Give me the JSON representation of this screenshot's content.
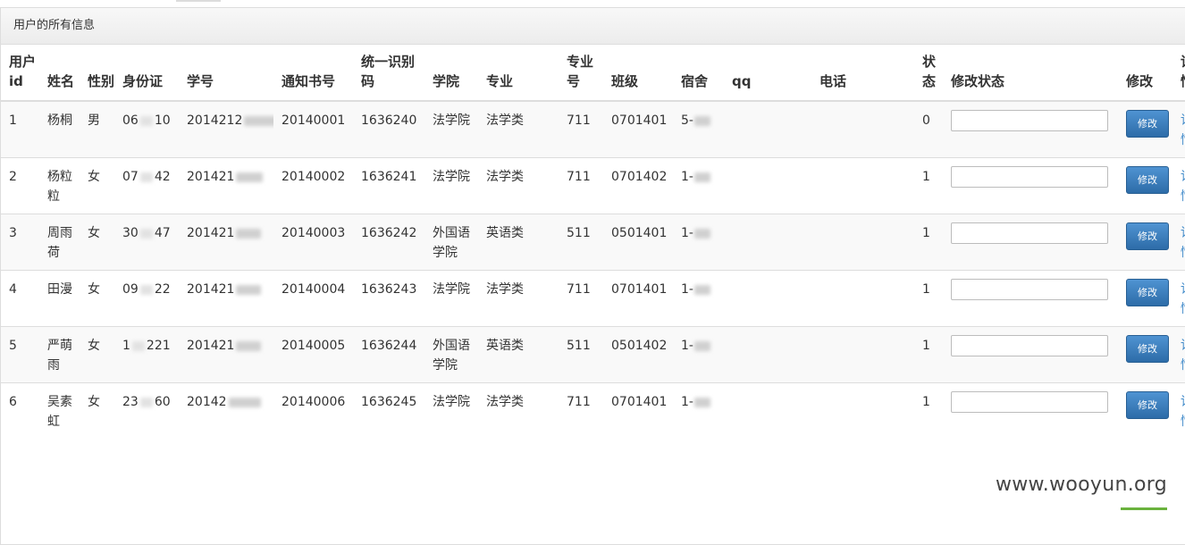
{
  "panel": {
    "title": "用户的所有信息"
  },
  "table": {
    "headers": {
      "user_id": "用户id",
      "name": "姓名",
      "gender": "性别",
      "id_card": "身份证",
      "student_no": "学号",
      "notice_no": "通知书号",
      "unified_code": "统一识别码",
      "college": "学院",
      "major": "专业",
      "major_no": "专业号",
      "class": "班级",
      "dorm": "宿舍",
      "qq": "qq",
      "phone": "电话",
      "status": "状态",
      "modify_status": "修改状态",
      "modify": "修改",
      "extra": "详情"
    },
    "rows": [
      {
        "user_id": "1",
        "name": "杨桐",
        "gender": "男",
        "id_card_start": "06",
        "id_card_end": "10",
        "student_no_prefix": "2014212",
        "notice_no": "20140001",
        "unified_code": "1636240",
        "college": "法学院",
        "major": "法学类",
        "major_no": "711",
        "class": "0701401",
        "dorm_prefix": "5-",
        "qq": "",
        "phone": "",
        "status": "0",
        "modify_status_value": "",
        "button_label": "修改",
        "extra": "详情"
      },
      {
        "user_id": "2",
        "name": "杨粒粒",
        "gender": "女",
        "id_card_start": "07",
        "id_card_end": "42",
        "student_no_prefix": "201421",
        "notice_no": "20140002",
        "unified_code": "1636241",
        "college": "法学院",
        "major": "法学类",
        "major_no": "711",
        "class": "0701402",
        "dorm_prefix": "1-",
        "qq": "",
        "phone": "",
        "status": "1",
        "modify_status_value": "",
        "button_label": "修改",
        "extra": "详情"
      },
      {
        "user_id": "3",
        "name": "周雨荷",
        "gender": "女",
        "id_card_start": "30",
        "id_card_end": "47",
        "student_no_prefix": "201421",
        "notice_no": "20140003",
        "unified_code": "1636242",
        "college": "外国语学院",
        "major": "英语类",
        "major_no": "511",
        "class": "0501401",
        "dorm_prefix": "1-",
        "qq": "",
        "phone": "",
        "status": "1",
        "modify_status_value": "",
        "button_label": "修改",
        "extra": "详情"
      },
      {
        "user_id": "4",
        "name": "田漫",
        "gender": "女",
        "id_card_start": "09",
        "id_card_end": "22",
        "student_no_prefix": "201421",
        "notice_no": "20140004",
        "unified_code": "1636243",
        "college": "法学院",
        "major": "法学类",
        "major_no": "711",
        "class": "0701401",
        "dorm_prefix": "1-",
        "qq": "",
        "phone": "",
        "status": "1",
        "modify_status_value": "",
        "button_label": "修改",
        "extra": "详情"
      },
      {
        "user_id": "5",
        "name": "严萌雨",
        "gender": "女",
        "id_card_start": "1",
        "id_card_end": "221",
        "student_no_prefix": "201421",
        "notice_no": "20140005",
        "unified_code": "1636244",
        "college": "外国语学院",
        "major": "英语类",
        "major_no": "511",
        "class": "0501402",
        "dorm_prefix": "1-",
        "qq": "",
        "phone": "",
        "status": "1",
        "modify_status_value": "",
        "button_label": "修改",
        "extra": "详情"
      },
      {
        "user_id": "6",
        "name": "吴素虹",
        "gender": "女",
        "id_card_start": "23",
        "id_card_end": "60",
        "student_no_prefix": "20142",
        "notice_no": "20140006",
        "unified_code": "1636245",
        "college": "法学院",
        "major": "法学类",
        "major_no": "711",
        "class": "0701401",
        "dorm_prefix": "1-",
        "qq": "",
        "phone": "",
        "status": "1",
        "modify_status_value": "",
        "button_label": "修改",
        "extra": "详情"
      }
    ]
  },
  "watermark": "www.wooyun.org",
  "colors": {
    "button": "#337ab7",
    "link": "#428bca",
    "stripe": "#f9f9f9",
    "border": "#dddddd"
  }
}
